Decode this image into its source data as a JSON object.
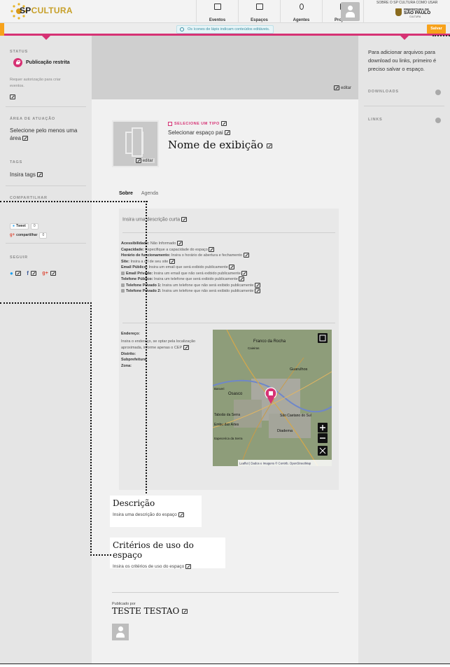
{
  "header": {
    "logo_prefix": "SP",
    "logo_text": "CULTURA",
    "nav": [
      {
        "label": "Eventos",
        "icon": "calendar-icon"
      },
      {
        "label": "Espaços",
        "icon": "building-icon"
      },
      {
        "label": "Agentes",
        "icon": "person-icon"
      },
      {
        "label": "Projetos",
        "icon": "document-icon"
      }
    ],
    "top_links": "SOBRE O SP CULTURA   COMO USAR",
    "pref_l1": "PREFEITURA DE",
    "pref_l2": "SÃO PAULO",
    "pref_l3": "CULTURA"
  },
  "editbar": {
    "tip": "Os ícones de lápis indicam conteúdos editáveis.",
    "save_label": "Salvar"
  },
  "left": {
    "status_title": "STATUS",
    "status_label": "Publicação restrita",
    "status_desc_1": "Requer autorização para criar",
    "status_desc_2": "eventos.",
    "area_title": "ÁREA DE ATUAÇÃO",
    "area_text_1": "Selecione pelo menos uma",
    "area_text_2": "área",
    "tags_title": "TAGS",
    "tags_text": "Insira tags",
    "share_title": "COMPARTILHAR",
    "tweet_label": "Tweet",
    "tweet_count": "0",
    "gplus_label": "compartilhar",
    "gplus_count": "0",
    "follow_title": "SEGUIR"
  },
  "main": {
    "cover_edit": "editar",
    "avatar_edit": "editar",
    "type_label": "SELECIONE UM TIPO",
    "parent_label": "Selecionar espaço pai",
    "name": "Nome de exibição",
    "tabs": [
      "Sobre",
      "Agenda"
    ],
    "short_desc": "Insira uma descrição curta",
    "fields": [
      {
        "label": "Acessibilidade:",
        "value": "Não Informado",
        "lock": false
      },
      {
        "label": "Capacidade:",
        "value": "Especifique a capacidade do espaço",
        "lock": false
      },
      {
        "label": "Horário de funcionamento:",
        "value": "Insira o horário de abertura e fechamento",
        "lock": false
      },
      {
        "label": "Site:",
        "value": "Insira a url de seu site",
        "lock": false
      },
      {
        "label": "Email Público:",
        "value": "Insira um email que será exibido publicamente",
        "lock": false
      },
      {
        "label": "Email Privado:",
        "value": "Insira um email que não será exibido publicamente",
        "lock": true
      },
      {
        "label": "Telefone Público:",
        "value": "Insira um telefone que será exibido publicamente",
        "lock": false
      },
      {
        "label": "Telefone Privado 1:",
        "value": "Insira um telefone que não será exibido publicamente",
        "lock": true
      },
      {
        "label": "Telefone Privado 2:",
        "value": "Insira um telefone que não será exibido publicamente",
        "lock": true
      }
    ],
    "address_label": "Endereço:",
    "address_hint_1": "Insira o endereço, se optar pela localização",
    "address_hint_2": "aproximada, informe apenas o CEP",
    "district_label": "Distrito:",
    "subpref_label": "Subprefeitura:",
    "zone_label": "Zona:",
    "map": {
      "places": [
        "Franco da Rocha",
        "Caieiras",
        "Guarulhos",
        "Osasco",
        "Barueri",
        "Taboão da Serra",
        "Embu das Artes",
        "Itapecerica da Serra",
        "São Caetano do Sul",
        "Diadema"
      ],
      "attribution": "Leaflet | Dados e Imagens © Contrib. OpenStreetMap"
    },
    "desc_title": "Descrição",
    "desc_text": "Insira uma descrição do espaço",
    "crit_title": "Critérios de uso do espaço",
    "crit_text": "Insira os critérios de uso do espaço",
    "pub_label": "Publicado por",
    "pub_name": "TESTE TESTAO"
  },
  "right": {
    "info_1": "Para adicionar arquivos para",
    "info_2": "download ou links, primeiro é",
    "info_3": "preciso salvar o espaço.",
    "downloads_title": "DOWNLOADS",
    "links_title": "LINKS"
  },
  "colors": {
    "accent": "#d63274",
    "orange": "#f7a21b",
    "sidebar": "#e5e5e5"
  }
}
